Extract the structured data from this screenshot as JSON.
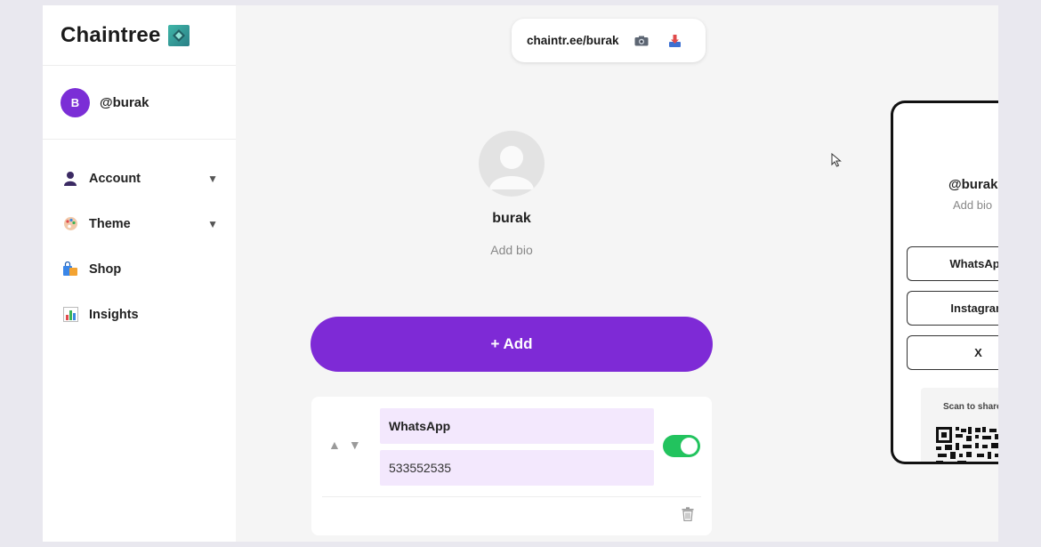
{
  "brand": {
    "name": "Chaintree",
    "logo_icon": "cube-logo-icon"
  },
  "user": {
    "initial": "B",
    "handle": "@burak"
  },
  "nav": [
    {
      "label": "Account",
      "icon": "person-icon",
      "has_caret": true
    },
    {
      "label": "Theme",
      "icon": "palette-icon",
      "has_caret": true
    },
    {
      "label": "Shop",
      "icon": "shopping-bags-icon",
      "has_caret": false
    },
    {
      "label": "Insights",
      "icon": "bar-chart-icon",
      "has_caret": false
    }
  ],
  "caret": "▼",
  "share": {
    "url": "chaintr.ee/burak",
    "buttons": [
      "camera-icon",
      "download-icon"
    ]
  },
  "profile": {
    "name": "burak",
    "bio_placeholder": "Add bio"
  },
  "editor": {
    "add_label": "+ Add",
    "links": [
      {
        "title": "WhatsApp",
        "value": "533552535",
        "enabled": true
      }
    ],
    "arrow_up": "▲",
    "arrow_down": "▼"
  },
  "preview": {
    "handle": "@burak",
    "bio": "Add bio",
    "links": [
      "WhatsApp",
      "Instagram",
      "X"
    ],
    "qr_label": "Scan to share"
  },
  "colors": {
    "accent": "#7e2ad6",
    "toggle_on": "#22c35e",
    "field_bg": "#f3e8fd"
  }
}
